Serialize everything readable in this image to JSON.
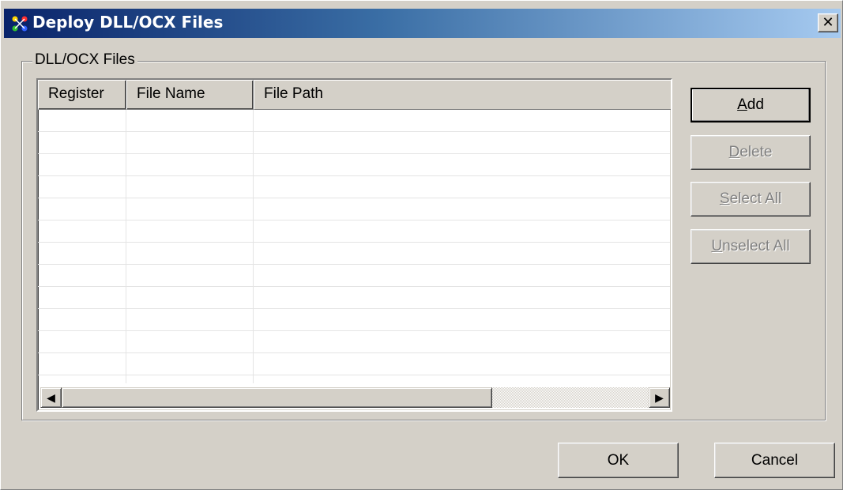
{
  "window": {
    "title": "Deploy DLL/OCX Files",
    "close_glyph": "✕",
    "icon": "app-icon"
  },
  "group": {
    "label": "DLL/OCX Files"
  },
  "list": {
    "columns": [
      "Register",
      "File Name",
      "File Path"
    ],
    "rows": []
  },
  "scrollbar": {
    "left_glyph": "◀",
    "right_glyph": "▶"
  },
  "buttons": {
    "add": {
      "mnemonic": "A",
      "rest": "dd",
      "enabled": true
    },
    "delete": {
      "mnemonic": "D",
      "rest": "elete",
      "enabled": false
    },
    "select_all": {
      "mnemonic": "S",
      "rest": "elect All",
      "enabled": false
    },
    "unselect_all": {
      "mnemonic": "U",
      "rest": "nselect All",
      "enabled": false
    },
    "ok": "OK",
    "cancel": "Cancel"
  },
  "colors": {
    "dialog_bg": "#d4d0c8",
    "title_start": "#0a246a",
    "title_end": "#a6caf0"
  }
}
